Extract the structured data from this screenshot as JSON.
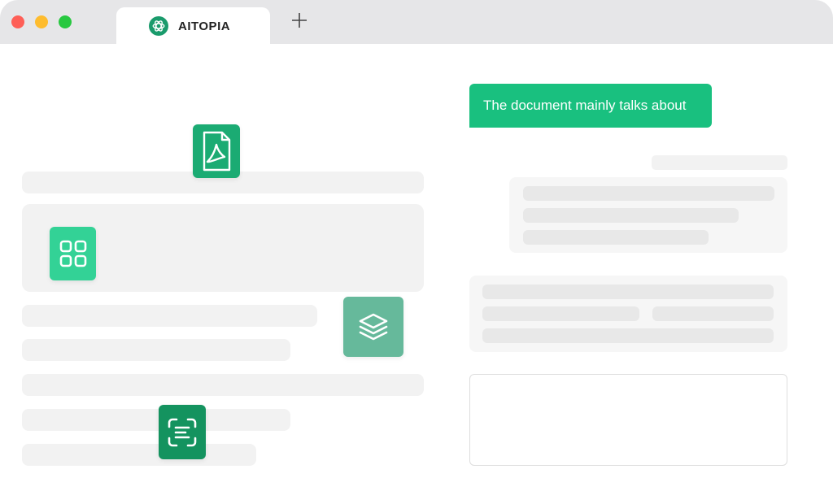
{
  "window": {
    "tab_title": "AITOPIA",
    "new_tab_symbol": "+"
  },
  "chat": {
    "message": "The document mainly talks about"
  },
  "icons": {
    "tab_logo": "openai-logo-icon",
    "pdf": "pdf-file-icon",
    "grid": "grid-icon",
    "layers": "layers-icon",
    "scan": "text-scan-icon"
  },
  "colors": {
    "accent": "#19c07f",
    "tab_logo": "#1a9b6c",
    "pdf_tile": "#1bab73",
    "grid_tile": "#33d296",
    "layers_tile": "#66b99b",
    "scan_tile": "#14935f",
    "skeleton": "#f2f2f2",
    "titlebar": "#e6e6e8"
  }
}
